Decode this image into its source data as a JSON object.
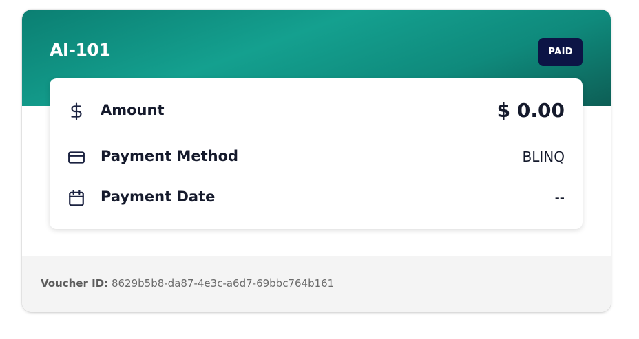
{
  "header": {
    "title": "AI-101",
    "status": "PAID"
  },
  "details": {
    "amount": {
      "icon": "dollar-icon",
      "label": "Amount",
      "value": "$ 0.00"
    },
    "payment_method": {
      "icon": "credit-card-icon",
      "label": "Payment Method",
      "value": "BLINQ"
    },
    "payment_date": {
      "icon": "calendar-icon",
      "label": "Payment Date",
      "value": "--"
    }
  },
  "footer": {
    "voucher_label": "Voucher ID:",
    "voucher_id": "8629b5b8-da87-4e3c-a6d7-69bbc764b161"
  },
  "colors": {
    "header_gradient": [
      "#0b7f72",
      "#14a08f",
      "#0d5e55"
    ],
    "badge_bg": "#0c1445",
    "footer_bg": "#f4f4f4"
  }
}
